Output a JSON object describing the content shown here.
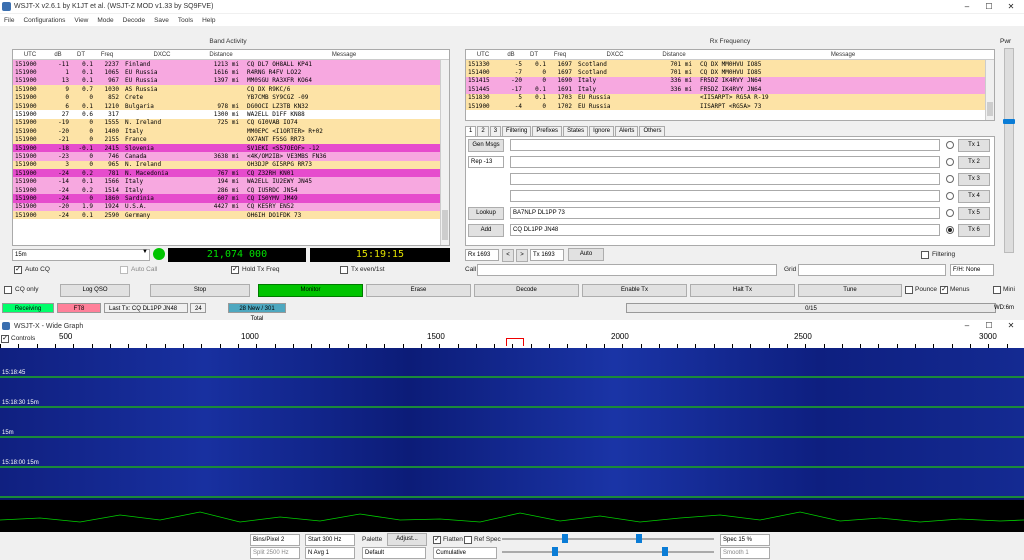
{
  "window": {
    "title": "WSJT-X   v2.6.1   by K1JT et al. (WSJT-Z MOD v1.33 by SQ9FVE)"
  },
  "menu": [
    "File",
    "Configurations",
    "View",
    "Mode",
    "Decode",
    "Save",
    "Tools",
    "Help"
  ],
  "band_activity": {
    "label": "Band Activity",
    "headers": [
      "UTC",
      "dB",
      "DT",
      "Freq",
      "DXCC",
      "Distance",
      "Message"
    ],
    "rows": [
      {
        "utc": "151900",
        "db": "-11",
        "dt": "0.1",
        "freq": "2237",
        "dxcc": "Finland",
        "dist": "1213 mi",
        "msg": "CQ DL7 OH8ALL KP41",
        "color": "#f7a8e0"
      },
      {
        "utc": "151900",
        "db": "1",
        "dt": "0.1",
        "freq": "1065",
        "dxcc": "EU Russia",
        "dist": "1616 mi",
        "msg": "R4RNG R4FV LO22",
        "color": "#f7a8e0"
      },
      {
        "utc": "151900",
        "db": "13",
        "dt": "0.1",
        "freq": "967",
        "dxcc": "EU Russia",
        "dist": "1397 mi",
        "msg": "MM0SGU RA3XFR KO64",
        "color": "#f7a8e0"
      },
      {
        "utc": "151900",
        "db": "9",
        "dt": "0.7",
        "freq": "1030",
        "dxcc": "AS Russia",
        "dist": "",
        "msg": "CQ DX R9KC/6",
        "color": "#fde3a6"
      },
      {
        "utc": "151900",
        "db": "0",
        "dt": "0",
        "freq": "852",
        "dxcc": "Crete",
        "dist": "",
        "msg": "YB7CMB SY9CGZ -09",
        "color": "#fde3a6"
      },
      {
        "utc": "151900",
        "db": "6",
        "dt": "0.1",
        "freq": "1210",
        "dxcc": "Bulgaria",
        "dist": "978 mi",
        "msg": "DG0OCI LZ3TB KN32",
        "color": "#fde3a6"
      },
      {
        "utc": "151900",
        "db": "27",
        "dt": "0.6",
        "freq": "317",
        "dxcc": "",
        "dist": "1300 mi",
        "msg": "WA2ELL D1FF KN88",
        "color": "#ffffff"
      },
      {
        "utc": "151900",
        "db": "-19",
        "dt": "0",
        "freq": "1555",
        "dxcc": "N. Ireland",
        "dist": "725 mi",
        "msg": "CQ GI0VAB IO74",
        "color": "#fde3a6"
      },
      {
        "utc": "151900",
        "db": "-20",
        "dt": "0",
        "freq": "1400",
        "dxcc": "Italy",
        "dist": "",
        "msg": "MM0EPC <I1ORTER> R+02",
        "color": "#fde3a6"
      },
      {
        "utc": "151900",
        "db": "-21",
        "dt": "0",
        "freq": "2155",
        "dxcc": "France",
        "dist": "",
        "msg": "OX7ANT F5SG RR73",
        "color": "#fde3a6"
      },
      {
        "utc": "151900",
        "db": "-18",
        "dt": "-0.1",
        "freq": "2415",
        "dxcc": "Slovenia",
        "dist": "",
        "msg": "SV1EKI <S57OEOF> -12",
        "color": "#e64ccd"
      },
      {
        "utc": "151900",
        "db": "-23",
        "dt": "0",
        "freq": "746",
        "dxcc": "Canada",
        "dist": "3638 mi",
        "msg": "<4K/OM2IB> VE3MBS FN36",
        "color": "#f7a8e0"
      },
      {
        "utc": "151900",
        "db": "3",
        "dt": "0",
        "freq": "965",
        "dxcc": "N. Ireland",
        "dist": "",
        "msg": "OH3DJP GI5RPG RR73",
        "color": "#fde3a6"
      },
      {
        "utc": "151900",
        "db": "-24",
        "dt": "0.2",
        "freq": "781",
        "dxcc": "N. Macedonia",
        "dist": "767 mi",
        "msg": "CQ Z32RH KN01",
        "color": "#e64ccd"
      },
      {
        "utc": "151900",
        "db": "-14",
        "dt": "0.1",
        "freq": "1566",
        "dxcc": "Italy",
        "dist": "194 mi",
        "msg": "WA2ELL IU2EWY JN45",
        "color": "#f7a8e0"
      },
      {
        "utc": "151900",
        "db": "-24",
        "dt": "0.2",
        "freq": "1514",
        "dxcc": "Italy",
        "dist": "286 mi",
        "msg": "CQ IU5RDC JN54",
        "color": "#f7a8e0"
      },
      {
        "utc": "151900",
        "db": "-24",
        "dt": "0",
        "freq": "1860",
        "dxcc": "Sardinia",
        "dist": "607 mi",
        "msg": "CQ IS0YMV JM49",
        "color": "#e64ccd"
      },
      {
        "utc": "151900",
        "db": "-20",
        "dt": "1.9",
        "freq": "1924",
        "dxcc": "U.S.A.",
        "dist": "4427 mi",
        "msg": "CQ KE5RY EN52",
        "color": "#f7a8e0"
      },
      {
        "utc": "151900",
        "db": "-24",
        "dt": "0.1",
        "freq": "2590",
        "dxcc": "Germany",
        "dist": "",
        "msg": "OH6IH DO1FDK 73",
        "color": "#fde3a6"
      }
    ]
  },
  "rx_frequency": {
    "label": "Rx Frequency",
    "headers": [
      "UTC",
      "dB",
      "DT",
      "Freq",
      "DXCC",
      "Distance",
      "Message"
    ],
    "rows": [
      {
        "utc": "151330",
        "db": "-5",
        "dt": "0.1",
        "freq": "1697",
        "dxcc": "Scotland",
        "dist": "701 mi",
        "msg": "CQ DX MM0HVU IO85",
        "color": "#fde3a6"
      },
      {
        "utc": "151400",
        "db": "-7",
        "dt": "0",
        "freq": "1697",
        "dxcc": "Scotland",
        "dist": "701 mi",
        "msg": "CQ DX MM0HVU IO85",
        "color": "#fde3a6"
      },
      {
        "utc": "151415",
        "db": "-20",
        "dt": "0",
        "freq": "1690",
        "dxcc": "Italy",
        "dist": "336 mi",
        "msg": "FR5DZ IK4RVY JN64",
        "color": "#f7a8e0"
      },
      {
        "utc": "151445",
        "db": "-17",
        "dt": "0.1",
        "freq": "1691",
        "dxcc": "Italy",
        "dist": "336 mi",
        "msg": "FR5DZ IK4RVY JN64",
        "color": "#f7a8e0"
      },
      {
        "utc": "151830",
        "db": "5",
        "dt": "0.1",
        "freq": "1703",
        "dxcc": "EU Russia",
        "dist": "",
        "msg": "<II5ARPT> RG5A R-19",
        "color": "#fde3a6"
      },
      {
        "utc": "151900",
        "db": "-4",
        "dt": "0",
        "freq": "1702",
        "dxcc": "EU Russia",
        "dist": "",
        "msg": "IISARPT <RG5A> 73",
        "color": "#fde3a6"
      }
    ]
  },
  "pwr_label": "Pwr",
  "tabs": [
    "1",
    "2",
    "3",
    "Filtering",
    "Prefixes",
    "States",
    "Ignore",
    "Alerts",
    "Others"
  ],
  "gen_msgs_label": "Gen Msgs",
  "rep_value": "Rep -13",
  "lookup_label": "Lookup",
  "add_label": "Add",
  "lookup_call": "BA7NLP DL1PP 73",
  "add_call": "CQ DL1PP JN48",
  "tx_buttons": [
    "Tx 1",
    "Tx 2",
    "Tx 3",
    "Tx 4",
    "Tx 5",
    "Tx 6"
  ],
  "filtering_label": "Filtering",
  "band_select": "15m",
  "dial_freq": "21,074 000",
  "utc_clock": "15:19:15",
  "auto_cq_label": "Auto CQ",
  "auto_call_label": "Auto Call",
  "hold_tx_freq_label": "Hold Tx Freq",
  "tx_even_label": "Tx even/1st",
  "rx_spin": "Rx 1693",
  "tx_spin": "Tx 1693",
  "auto_label": "Auto",
  "call_label": "Call",
  "grid_label": "Grid",
  "mode_select": "F/H: None",
  "cq_only_label": "CQ only",
  "buttons": {
    "log_qso": "Log QSO",
    "stop": "Stop",
    "monitor": "Monitor",
    "erase": "Erase",
    "decode": "Decode",
    "enable_tx": "Enable Tx",
    "halt_tx": "Halt Tx",
    "tune": "Tune"
  },
  "pounce_label": "Pounce",
  "menus_label": "Menus",
  "mini_label": "Mini",
  "status": {
    "receiving": "Receiving",
    "mode": "FT8",
    "last_tx": "Last Tx: CQ DL1PP JN48",
    "count": "24",
    "new_total": "28 New / 301 Total",
    "progress": "0/15",
    "wd": "WD:6m"
  },
  "wide_graph": {
    "title": "WSJT-X - Wide Graph",
    "controls_label": "Controls",
    "freq_ticks": [
      "500",
      "1000",
      "1500",
      "2000",
      "2500",
      "3000"
    ],
    "time_labels": [
      "15:18:45",
      "15:18:30 15m",
      "15m",
      "15:18:00 15m"
    ],
    "bins_pixel": "Bins/Pixel 2",
    "start": "Start 300 Hz",
    "palette_label": "Palette",
    "adjust_label": "Adjust...",
    "flatten_label": "Flatten",
    "ref_spec_label": "Ref Spec",
    "spec_value": "Spec 15 %",
    "split": "Split 2500 Hz",
    "n_avg": "N Avg 1",
    "palette_value": "Default",
    "spectrum_mode": "Cumulative",
    "smooth": "Smooth 1"
  },
  "colors": {
    "cq_row": "#fde3a6",
    "my_call": "#f7a8e0",
    "new_dxcc": "#e64ccd",
    "monitor_green": "#00c400",
    "receiving_green": "#00ff6a",
    "ft8_pink": "#ff8099",
    "new_total_teal": "#4ea8c0"
  }
}
